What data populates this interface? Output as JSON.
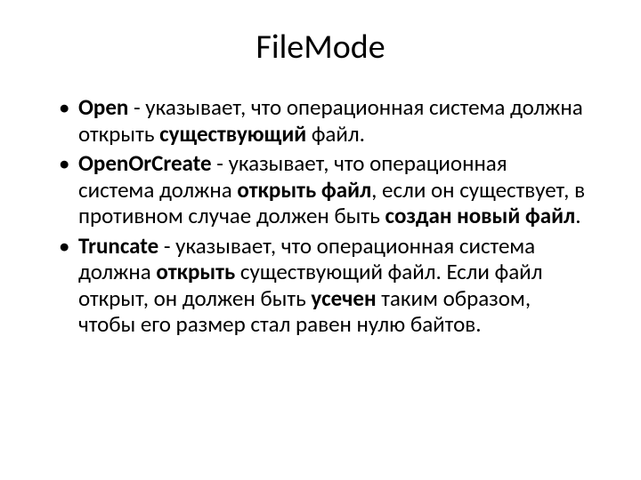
{
  "title": "FileMode",
  "items": [
    {
      "name": "Open",
      "sep": " - ",
      "p1": "указывает, что операционная система должна открыть ",
      "s1": "существующий",
      "p2": " файл."
    },
    {
      "name": "OpenOrCreate",
      "sep": " - ",
      "p1": "указывает, что операционная система должна ",
      "s1": "открыть файл",
      "p2": ", если он существует, в противном случае должен быть ",
      "s2": "создан новый файл",
      "p3": "."
    },
    {
      "name": "Truncate",
      "sep": " - ",
      "p1": "указывает, что операционная система должна ",
      "s1": "открыть",
      "p2": " существующий файл. Если файл открыт, он должен быть ",
      "s2": "усечен",
      "p3": " таким образом, чтобы его размер стал равен нулю байтов."
    }
  ]
}
